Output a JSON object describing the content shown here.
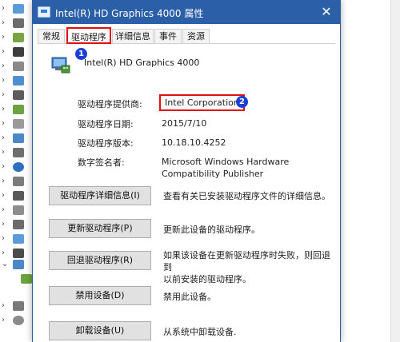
{
  "window": {
    "title": "Intel(R) HD Graphics 4000 属性",
    "close_glyph": "✕"
  },
  "tabs": [
    {
      "label": "常规",
      "active": false
    },
    {
      "label": "驱动程序",
      "active": true
    },
    {
      "label": "详细信息",
      "active": false
    },
    {
      "label": "事件",
      "active": false
    },
    {
      "label": "资源",
      "active": false
    }
  ],
  "device": {
    "name": "Intel(R) HD Graphics 4000",
    "icon": "display-adapter-icon"
  },
  "driver_info": [
    {
      "label": "驱动程序提供商:",
      "value": "Intel Corporation"
    },
    {
      "label": "驱动程序日期:",
      "value": "2015/7/10"
    },
    {
      "label": "驱动程序版本:",
      "value": "10.18.10.4252"
    },
    {
      "label": "数字签名者:",
      "value_lines": [
        "Microsoft Windows Hardware",
        "Compatibility Publisher"
      ]
    }
  ],
  "actions": [
    {
      "label": "驱动程序详细信息(I)",
      "desc_lines": [
        "查看有关已安装驱动程序文件的详细信息。"
      ]
    },
    {
      "label": "更新驱动程序(P)",
      "desc_lines": [
        "更新此设备的驱动程序。"
      ]
    },
    {
      "label": "回退驱动程序(R)",
      "desc_lines": [
        "如果该设备在更新驱动程序时失败，则回退到",
        "以前安装的驱动程序。"
      ]
    },
    {
      "label": "禁用设备(D)",
      "desc_lines": [
        "禁用此设备。"
      ]
    },
    {
      "label": "卸载设备(U)",
      "desc_lines": [
        "从系统中卸载设备."
      ]
    }
  ],
  "annotations": {
    "badge_1": "1",
    "badge_2": "2",
    "highlight_color": "#e01010",
    "badge_color": "#1a3fd6"
  },
  "colors": {
    "titlebar": "#2b5fa8",
    "button_face": "#e1e1e1"
  }
}
